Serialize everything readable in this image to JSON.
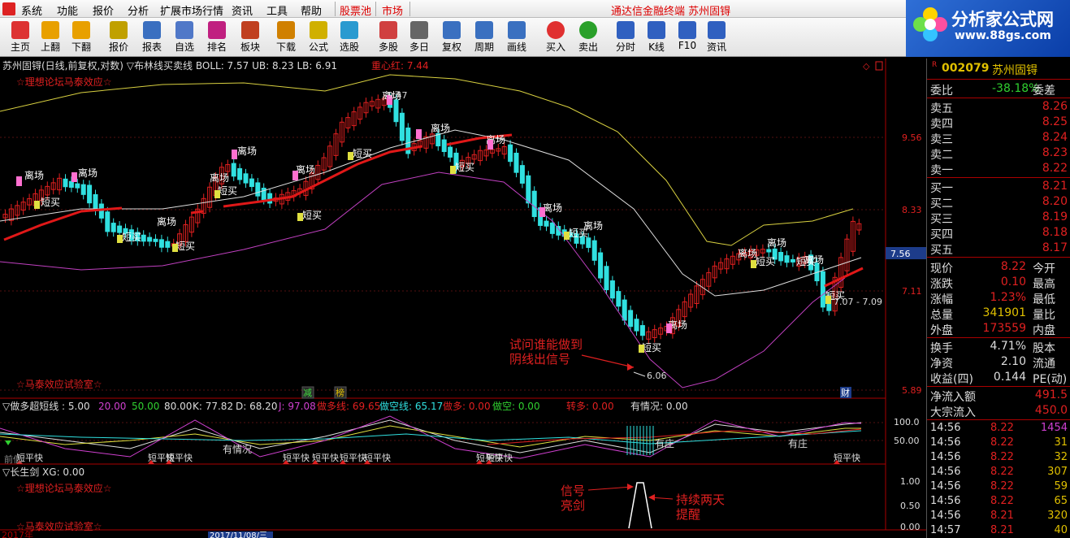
{
  "menu": [
    "系统",
    "功能",
    "报价",
    "分析",
    "扩展市场行情",
    "资讯",
    "工具",
    "帮助",
    "股票池",
    "市场"
  ],
  "window_title": "通达信金融终端  苏州固锝",
  "toolbar": [
    {
      "label": "主页",
      "icon": "home-icon"
    },
    {
      "label": "上翻",
      "icon": "up-arrow-icon"
    },
    {
      "label": "下翻",
      "icon": "down-arrow-icon"
    },
    {
      "label": "报价",
      "icon": "price-icon"
    },
    {
      "label": "报表",
      "icon": "report-icon"
    },
    {
      "label": "自选",
      "icon": "f6-icon"
    },
    {
      "label": "排名",
      "icon": "rank-icon"
    },
    {
      "label": "板块",
      "icon": "block-icon"
    },
    {
      "label": "下载",
      "icon": "download-icon"
    },
    {
      "label": "公式",
      "icon": "formula-icon"
    },
    {
      "label": "选股",
      "icon": "select-icon"
    },
    {
      "label": "多股",
      "icon": "multi-stock-icon"
    },
    {
      "label": "多日",
      "icon": "clock-icon"
    },
    {
      "label": "复权",
      "icon": "adjust-icon"
    },
    {
      "label": "周期",
      "icon": "f8-icon"
    },
    {
      "label": "画线",
      "icon": "draw-icon"
    },
    {
      "label": "买入",
      "icon": "buy-icon"
    },
    {
      "label": "卖出",
      "icon": "sell-icon"
    },
    {
      "label": "分时",
      "icon": "intraday-icon"
    },
    {
      "label": "K线",
      "icon": "kline-icon"
    },
    {
      "label": "F10",
      "icon": "f10-icon"
    },
    {
      "label": "资讯",
      "icon": "news-icon"
    }
  ],
  "promo": {
    "title": "分析家公式网",
    "url": "www.88gs.com"
  },
  "main_chart": {
    "header": "苏州固锝(日线,前复权,对数) ▽布林线买卖线  BOLL: 7.57  UB: 8.23  LB: 6.91",
    "center_line": "重心红: 7.44",
    "watermark_top": "☆理想论坛马泰效应☆",
    "watermark_bottom": "☆马泰效应试验室☆",
    "peak_label": "9.47",
    "low_label": "6.06",
    "last_label": "7.07 - 7.09",
    "annotation": [
      "试问谁能做到",
      "阴线出信号"
    ],
    "markers": {
      "leave": "离场",
      "short_buy": "短买",
      "jian": "减",
      "bang": "榜",
      "cai": "财"
    },
    "price_axis": [
      "9.56",
      "8.33",
      "7.11",
      "5.89"
    ],
    "current_price_tag": "7.56"
  },
  "indicator1": {
    "name": "▽做多超短线 : 5.00",
    "params": [
      "20.00",
      "50.00",
      "80.00"
    ],
    "values": [
      {
        "label": "K: 77.82",
        "color": "#dddddd"
      },
      {
        "label": "D: 68.20",
        "color": "#dddddd"
      },
      {
        "label": "J: 97.08",
        "color": "#d040d0"
      },
      {
        "label": "做多线: 69.65",
        "color": "#e02020"
      },
      {
        "label": "做空线: 65.17",
        "color": "#30e0e0"
      },
      {
        "label": "做多: 0.00",
        "color": "#e02020"
      },
      {
        "label": "做空: 0.00",
        "color": "#30d030"
      },
      {
        "label": "转多: 0.00",
        "color": "#e02020"
      },
      {
        "label": "有情况: 0.00",
        "color": "#dddddd"
      }
    ],
    "axis": [
      "100.0",
      "50.00"
    ],
    "labels": {
      "short_flat_fast": "短平快",
      "situation": "有情况",
      "dealer": "有庄",
      "prev_low": "前低"
    }
  },
  "indicator2": {
    "name": "▽长生剑  XG: 0.00",
    "watermark_top": "☆理想论坛马泰效应☆",
    "watermark_bottom": "☆马泰效应试验室☆",
    "note1": [
      "信号",
      "亮剑"
    ],
    "note2": [
      "持续两天",
      "提醒"
    ],
    "axis": [
      "1.00",
      "0.50",
      "0.00"
    ]
  },
  "date_axis": [
    "2017年",
    "2017/11/08/三"
  ],
  "quote": {
    "code": "002079",
    "name": "苏州固锝",
    "ratio": {
      "label": "委比",
      "value": "-38.18%",
      "right": "委差"
    },
    "sell": [
      {
        "label": "卖五",
        "price": "8.26"
      },
      {
        "label": "卖四",
        "price": "8.25"
      },
      {
        "label": "卖三",
        "price": "8.24"
      },
      {
        "label": "卖二",
        "price": "8.23"
      },
      {
        "label": "卖一",
        "price": "8.22"
      }
    ],
    "buy": [
      {
        "label": "买一",
        "price": "8.21"
      },
      {
        "label": "买二",
        "price": "8.20"
      },
      {
        "label": "买三",
        "price": "8.19"
      },
      {
        "label": "买四",
        "price": "8.18"
      },
      {
        "label": "买五",
        "price": "8.17"
      }
    ],
    "stats": [
      {
        "label": "现价",
        "value": "8.22",
        "right": "今开"
      },
      {
        "label": "涨跌",
        "value": "0.10",
        "right": "最高"
      },
      {
        "label": "涨幅",
        "value": "1.23%",
        "right": "最低"
      },
      {
        "label": "总量",
        "value": "341901",
        "right": "量比"
      },
      {
        "label": "外盘",
        "value": "173559",
        "right": "内盘"
      }
    ],
    "stats2": [
      {
        "label": "换手",
        "value": "4.71%",
        "right": "股本"
      },
      {
        "label": "净资",
        "value": "2.10",
        "right": "流通"
      },
      {
        "label": "收益(四)",
        "value": "0.144",
        "right": "PE(动)"
      }
    ],
    "flow": [
      {
        "label": "净流入额",
        "value": "491.5"
      },
      {
        "label": "大宗流入",
        "value": "450.0"
      }
    ],
    "ticks": [
      {
        "time": "14:56",
        "price": "8.22",
        "vol": "1454"
      },
      {
        "time": "14:56",
        "price": "8.22",
        "vol": "31"
      },
      {
        "time": "14:56",
        "price": "8.22",
        "vol": "32"
      },
      {
        "time": "14:56",
        "price": "8.22",
        "vol": "307"
      },
      {
        "time": "14:56",
        "price": "8.22",
        "vol": "59"
      },
      {
        "time": "14:56",
        "price": "8.22",
        "vol": "65"
      },
      {
        "time": "14:56",
        "price": "8.21",
        "vol": "320"
      },
      {
        "time": "14:57",
        "price": "8.21",
        "vol": "40"
      }
    ]
  }
}
